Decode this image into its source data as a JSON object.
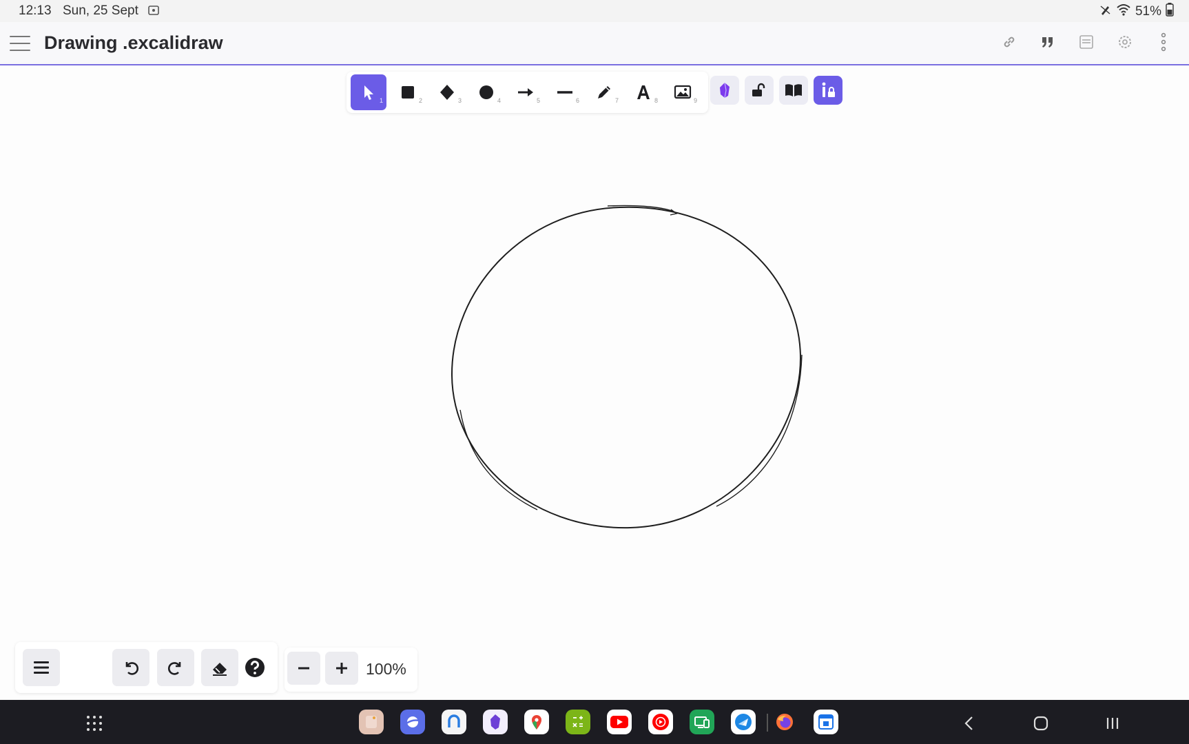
{
  "status": {
    "time": "12:13",
    "date": "Sun, 25 Sept",
    "battery": "51%"
  },
  "header": {
    "title": "Drawing .excalidraw",
    "menu_icon": "hamburger-icon",
    "actions": [
      "link-icon",
      "quote-icon",
      "save-icon",
      "settings-icon",
      "more-vertical-icon"
    ]
  },
  "toolbar": {
    "tools": [
      {
        "name": "selection",
        "key": "1",
        "active": true
      },
      {
        "name": "rectangle",
        "key": "2"
      },
      {
        "name": "diamond",
        "key": "3"
      },
      {
        "name": "ellipse",
        "key": "4"
      },
      {
        "name": "arrow",
        "key": "5"
      },
      {
        "name": "line",
        "key": "6"
      },
      {
        "name": "draw",
        "key": "7"
      },
      {
        "name": "text",
        "key": "8"
      },
      {
        "name": "image",
        "key": "9"
      }
    ],
    "extras": [
      "obsidian-icon",
      "lock-icon",
      "library-icon",
      "info-lock-icon"
    ]
  },
  "bottom": {
    "zoom_level": "100%"
  },
  "colors": {
    "accent": "#6b5ce7",
    "header_border": "#7a6ee0",
    "navbar": "#1c1c22"
  }
}
